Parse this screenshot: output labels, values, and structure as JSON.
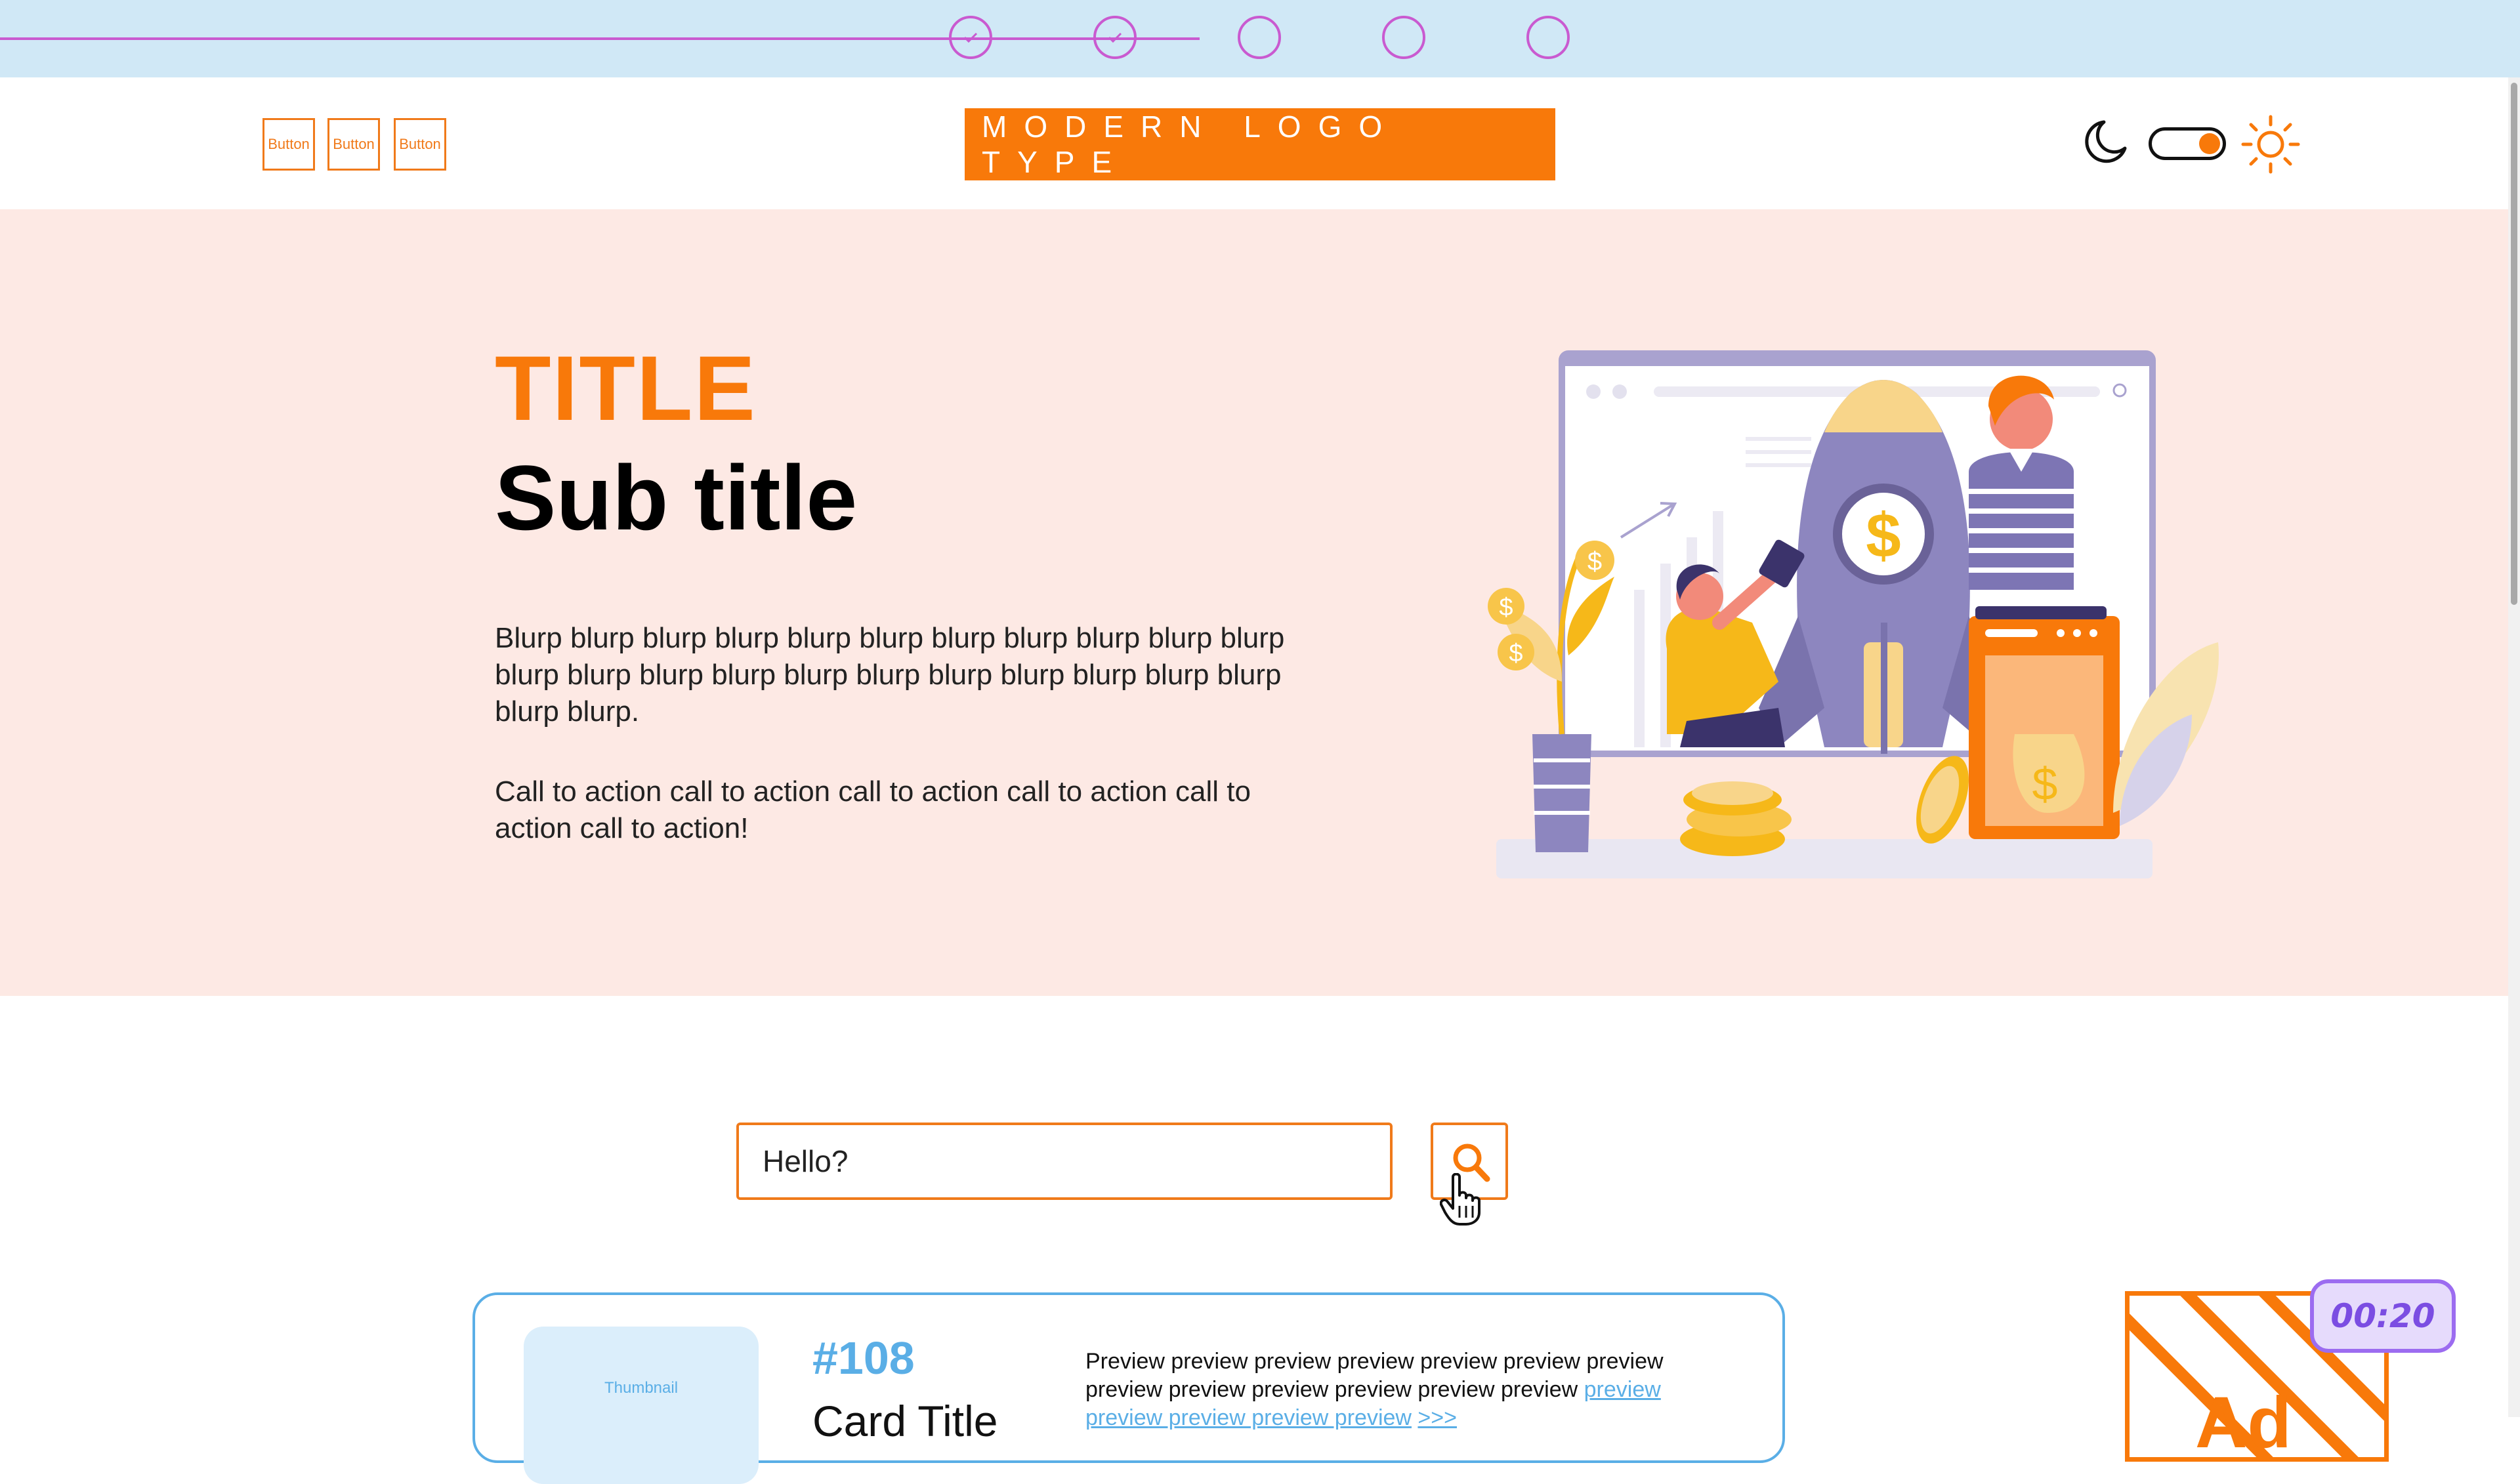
{
  "stepper": {
    "total_steps": 5,
    "completed_steps": 2,
    "active_color": "#c95ad0"
  },
  "header": {
    "buttons": [
      "Button",
      "Button",
      "Button"
    ],
    "logo": "MODERN LOGO TYPE",
    "theme_toggle": {
      "moon_icon": "moon-icon",
      "sun_icon": "sun-icon",
      "state": "light"
    }
  },
  "hero": {
    "title": "TITLE",
    "subtitle": "Sub title",
    "body": "Blurp blurp blurp blurp blurp blurp blurp blurp blurp blurp blurp blurp blurp blurp blurp blurp blurp blurp blurp blurp blurp blurp blurp blurp.",
    "cta": "Call to action call to action call to action call to action call to action call to action!"
  },
  "search": {
    "value": "Hello?",
    "button_icon": "search-icon"
  },
  "card": {
    "thumbnail_label": "Thumbnail",
    "number": "#108",
    "title": "Card Title",
    "preview": "Preview preview preview preview preview preview preview preview preview preview preview preview preview",
    "preview_more": "preview preview preview preview preview",
    "more_arrow": ">>>"
  },
  "ad": {
    "label": "Ad",
    "timer": "00:20"
  },
  "colors": {
    "accent": "#f8790a",
    "card_accent": "#5aaee6",
    "hero_bg": "#fde9e4",
    "stepper_bg": "#d0e8f6",
    "timer": "#9c6cf0"
  }
}
